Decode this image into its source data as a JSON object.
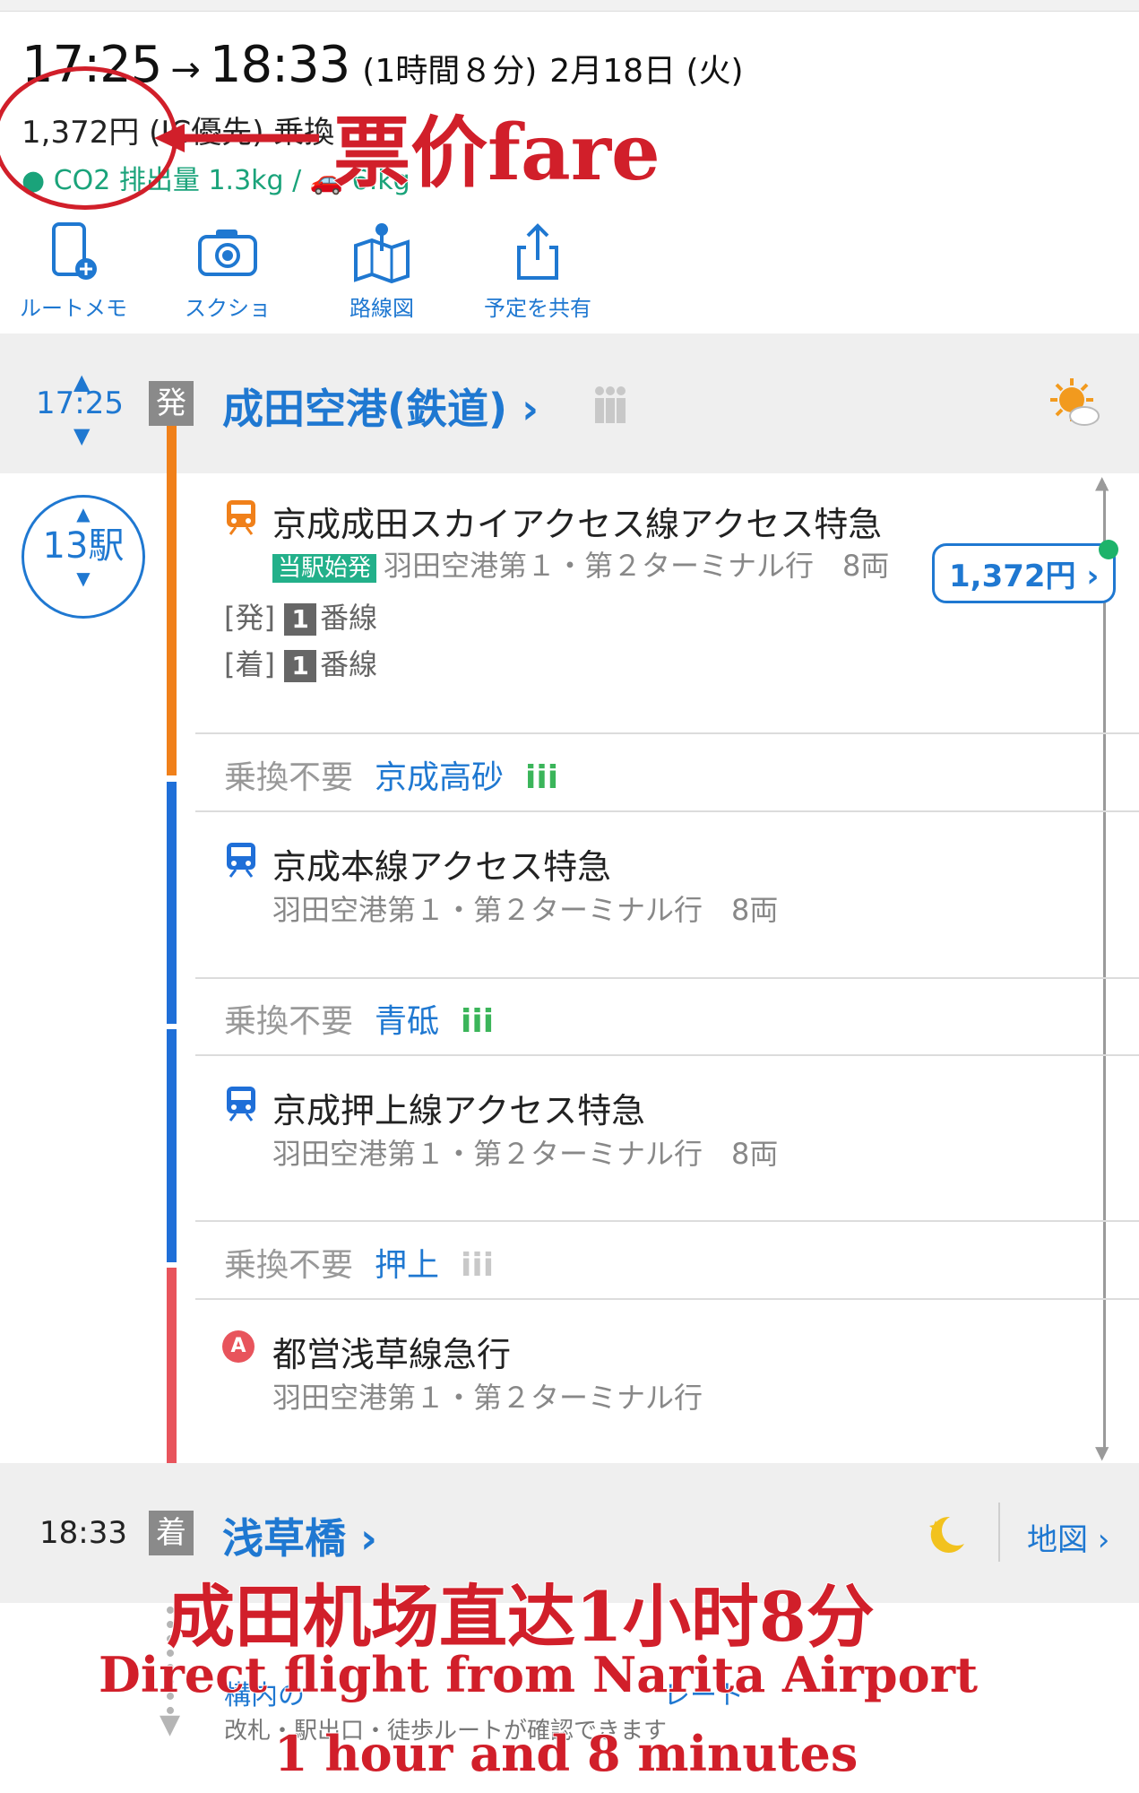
{
  "summary": {
    "depart_time": "17:25",
    "arrive_time": "18:33",
    "duration": "(1時間８分)",
    "date": "2月18日 (火)",
    "fare_text": "1,372円",
    "fare_note": "(IC優先) 乗換",
    "co2_text": "CO2 排出量 1.3kg / ",
    "co2_tail": "6.",
    "co2_end": "kg"
  },
  "actions": [
    {
      "label": "ルートメモ",
      "icon": "phone-memo-icon"
    },
    {
      "label": "スクショ",
      "icon": "camera-icon"
    },
    {
      "label": "路線図",
      "icon": "route-map-icon"
    },
    {
      "label": "予定を共有",
      "icon": "share-icon"
    }
  ],
  "origin": {
    "time": "17:25",
    "tag": "発",
    "name": "成田空港(鉄道)",
    "chevron": "›",
    "weather_icon": "sun-cloud-icon"
  },
  "stops": {
    "count": "13駅"
  },
  "fare_button": "1,372円 ›",
  "segments": [
    {
      "name": "京成成田スカイアクセス線アクセス特急",
      "badge": "当駅始発",
      "dest": "羽田空港第１・第２ターミナル行　8両",
      "dep_label": "[発]",
      "dep_platform": "1",
      "arr_label": "[着]",
      "arr_platform": "1",
      "platform_suffix": "番線",
      "color": "#f0801a"
    },
    {
      "name": "京成本線アクセス特急",
      "dest": "羽田空港第１・第２ターミナル行　8両",
      "color": "#1f6fd8"
    },
    {
      "name": "京成押上線アクセス特急",
      "dest": "羽田空港第１・第２ターミナル行　8両",
      "color": "#1f6fd8"
    },
    {
      "name": "都営浅草線急行",
      "dest": "羽田空港第１・第２ターミナル行",
      "color": "#e8545c",
      "line_letter": "A"
    }
  ],
  "transfers": [
    {
      "label": "乗換不要",
      "station": "京成高砂"
    },
    {
      "label": "乗換不要",
      "station": "青砥"
    },
    {
      "label": "乗換不要",
      "station": "押上"
    }
  ],
  "destination": {
    "time": "18:33",
    "tag": "着",
    "name": "浅草橋",
    "chevron": "›",
    "map_label": "地図 ›",
    "weather_icon": "moon-icon"
  },
  "footer": {
    "line1": "構内の",
    "line1_tail": "レート",
    "line2": "改札・駅出口・徒歩ルートが確認できます"
  },
  "overlays": {
    "fare_cn": "票价fare",
    "headline_cn": "成田机场直达1小时8分",
    "headline_en1": "Direct flight from Narita Airport",
    "headline_en2": "1 hour and 8 minutes"
  }
}
